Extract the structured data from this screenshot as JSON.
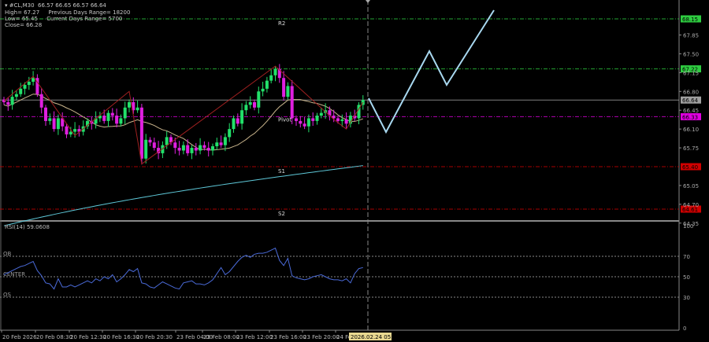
{
  "header": {
    "symbol_line": "#CL,M30  66.57 66.65 66.57 66.64",
    "high": "High= 67.27",
    "prev_range": "Previous Days Range= 18200",
    "low": "Low= 65.45",
    "cur_range": "Current Days Range= 5700",
    "close": "Close= 66.28"
  },
  "chart_data": {
    "type": "candlestick",
    "symbol": "#CL",
    "timeframe": "M30",
    "closes": [
      66.6,
      66.55,
      66.7,
      66.75,
      66.85,
      66.92,
      66.98,
      67.05,
      66.75,
      66.5,
      66.25,
      66.3,
      66.1,
      66.3,
      66.15,
      66.0,
      66.05,
      66.1,
      66.05,
      66.15,
      66.25,
      66.2,
      66.3,
      66.35,
      66.25,
      66.4,
      66.35,
      66.2,
      66.3,
      66.5,
      66.6,
      66.45,
      66.5,
      65.55,
      65.9,
      65.85,
      65.75,
      65.65,
      65.8,
      65.95,
      65.85,
      65.75,
      65.7,
      65.8,
      65.65,
      65.75,
      65.7,
      65.8,
      65.75,
      65.7,
      65.78,
      65.85,
      65.8,
      65.95,
      66.1,
      66.3,
      66.2,
      66.45,
      66.55,
      66.6,
      66.5,
      66.8,
      66.85,
      67.0,
      67.1,
      67.22,
      67.05,
      66.7,
      66.9,
      66.3,
      66.25,
      66.2,
      66.15,
      66.3,
      66.25,
      66.35,
      66.4,
      66.45,
      66.35,
      66.3,
      66.25,
      66.28,
      66.2,
      66.35,
      66.3,
      66.55,
      66.64
    ],
    "price_ticks": [
      "67.85",
      "67.50",
      "67.15",
      "66.80",
      "66.45",
      "66.10",
      "65.75",
      "65.05",
      "64.70",
      "64.35"
    ],
    "levels": [
      {
        "label": "R2",
        "value": 68.15,
        "tag": "68.15",
        "color": "#2ecc40"
      },
      {
        "label": "",
        "value": 67.22,
        "tag": "67.22",
        "color": "#2ecc40"
      },
      {
        "label": "",
        "value": 66.64,
        "tag": "66.64",
        "color": "#a0a0a0"
      },
      {
        "label": "Pivot",
        "value": 66.33,
        "tag": "66.33",
        "color": "#e000e0"
      },
      {
        "label": "S1",
        "value": 65.4,
        "tag": "65.40",
        "color": "#d00000"
      },
      {
        "label": "S2",
        "value": 64.61,
        "tag": "64.61",
        "color": "#d00000"
      }
    ],
    "up_color": "#22e06a",
    "down_color": "#e020e0",
    "ma_color": "#c8b48c",
    "long_ma_color": "#5ec8d8",
    "zigzag_color": "#a02020",
    "projection_color": "#a8d8f0",
    "time_labels": [
      "20 Feb 2026",
      "20 Feb 08:30",
      "20 Feb 12:30",
      "20 Feb 16:30",
      "20 Feb 20:30",
      "23 Feb 04:00",
      "23 Feb 08:00",
      "23 Feb 12:00",
      "23 Feb 16:00",
      "23 Feb 20:00",
      "24 Fe"
    ],
    "crosshair_time": "2026.02.24 05:00",
    "rsi": {
      "title": "RSI(14) 59.0608",
      "period": 14,
      "color": "#4a6ad8",
      "levels": [
        {
          "label": "OB",
          "value": 70
        },
        {
          "label": "CENTER",
          "value": 50
        },
        {
          "label": "OS",
          "value": 30
        }
      ],
      "ticks": [
        "100",
        "70",
        "50",
        "30",
        "0"
      ],
      "ylim": [
        0,
        100
      ],
      "values": [
        52,
        54,
        56,
        58,
        60,
        61,
        63,
        65,
        56,
        51,
        44,
        43,
        38,
        48,
        40,
        40,
        42,
        40,
        42,
        44,
        46,
        44,
        48,
        46,
        50,
        48,
        52,
        45,
        48,
        52,
        57,
        55,
        58,
        44,
        43,
        40,
        39,
        42,
        45,
        43,
        41,
        39,
        38,
        44,
        45,
        46,
        43,
        43,
        42,
        44,
        47,
        53,
        59,
        52,
        55,
        60,
        65,
        69,
        71,
        69,
        72,
        73,
        73,
        74,
        76,
        78,
        66,
        61,
        68,
        51,
        49,
        48,
        47,
        48,
        50,
        51,
        52,
        50,
        48,
        47,
        47,
        46,
        48,
        44,
        53,
        58,
        59
      ]
    }
  }
}
